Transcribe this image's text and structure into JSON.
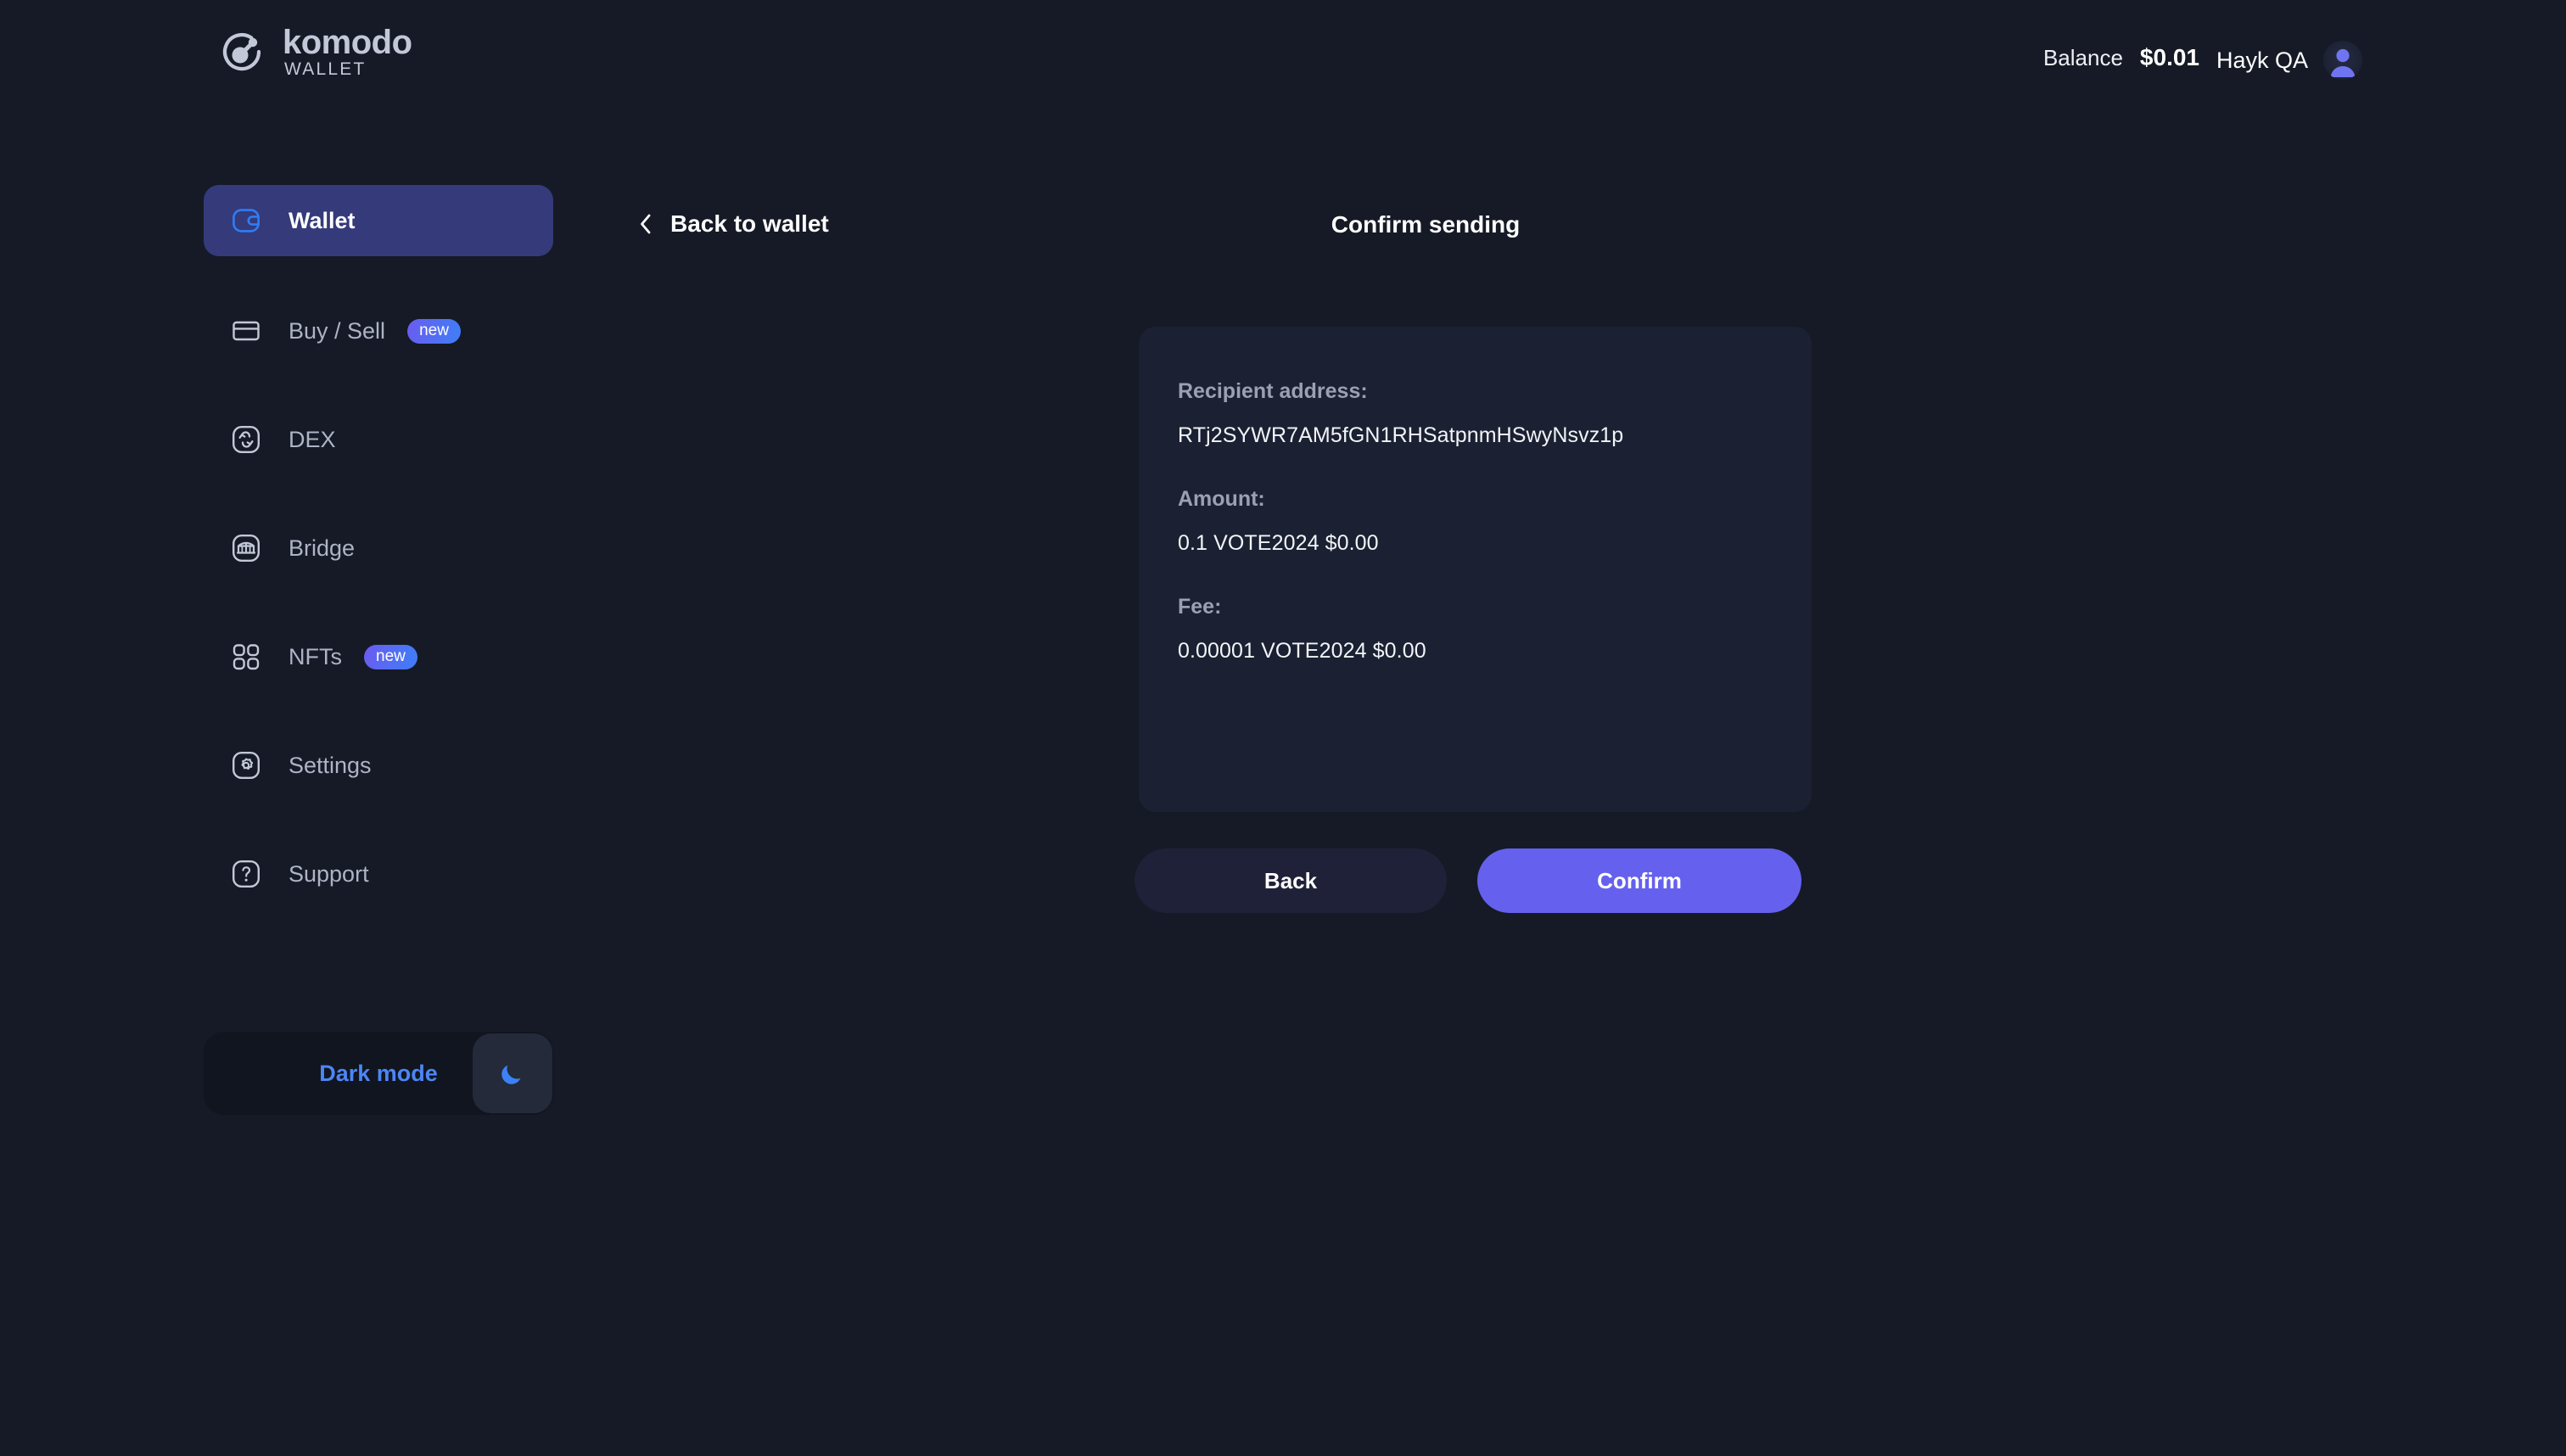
{
  "app": {
    "logo_name": "komodo",
    "logo_sub": "WALLET",
    "logo_icon": "komodo-logo-icon"
  },
  "header": {
    "balance_label": "Balance",
    "balance_value": "$0.01",
    "user_name": "Hayk QA",
    "avatar_icon": "user-avatar-icon"
  },
  "sidebar": {
    "items": [
      {
        "label": "Wallet",
        "icon": "wallet-icon",
        "active": true,
        "badge": ""
      },
      {
        "label": "Buy / Sell",
        "icon": "card-icon",
        "active": false,
        "badge": "new"
      },
      {
        "label": "DEX",
        "icon": "swap-icon",
        "active": false,
        "badge": ""
      },
      {
        "label": "Bridge",
        "icon": "bridge-icon",
        "active": false,
        "badge": ""
      },
      {
        "label": "NFTs",
        "icon": "grid-icon",
        "active": false,
        "badge": "new"
      },
      {
        "label": "Settings",
        "icon": "gear-icon",
        "active": false,
        "badge": ""
      },
      {
        "label": "Support",
        "icon": "question-icon",
        "active": false,
        "badge": ""
      }
    ],
    "dark_mode": {
      "label": "Dark mode",
      "icon": "moon-icon",
      "enabled": true
    }
  },
  "main": {
    "back_label": "Back to wallet",
    "back_icon": "chevron-left-icon",
    "title": "Confirm sending",
    "fields": [
      {
        "label": "Recipient address:",
        "value": "RTj2SYWR7AM5fGN1RHSatpnmHSwyNsvz1p"
      },
      {
        "label": "Amount:",
        "value": "0.1 VOTE2024 $0.00"
      },
      {
        "label": "Fee:",
        "value": "0.00001 VOTE2024 $0.00"
      }
    ],
    "buttons": {
      "back": "Back",
      "confirm": "Confirm"
    }
  },
  "colors": {
    "page_bg": "#151a26",
    "card_bg": "#1b2132",
    "active_nav_bg": "#353a7a",
    "accent_blue": "#2f7df6",
    "confirm_purple": "#6561ee",
    "badge_gradient_from": "#6a5cf0",
    "badge_gradient_to": "#3f7ef7",
    "dark_mode_text": "#4d85f5"
  }
}
